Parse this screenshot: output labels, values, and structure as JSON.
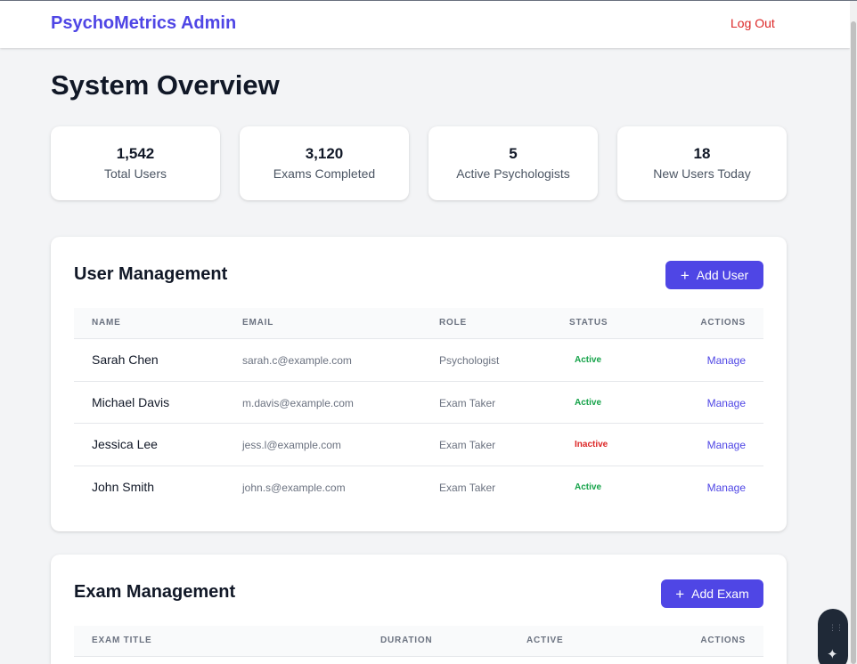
{
  "header": {
    "brand": "PsychoMetrics Admin",
    "logout_label": "Log Out"
  },
  "page": {
    "title": "System Overview"
  },
  "stats": [
    {
      "value": "1,542",
      "label": "Total Users"
    },
    {
      "value": "3,120",
      "label": "Exams Completed"
    },
    {
      "value": "5",
      "label": "Active Psychologists"
    },
    {
      "value": "18",
      "label": "New Users Today"
    }
  ],
  "user_management": {
    "title": "User Management",
    "add_button_label": "Add User",
    "add_button_icon": "plus-icon",
    "columns": [
      "Name",
      "Email",
      "Role",
      "Status",
      "Actions"
    ],
    "rows": [
      {
        "name": "Sarah Chen",
        "email": "sarah.c@example.com",
        "role": "Psychologist",
        "status": "Active",
        "action": "Manage"
      },
      {
        "name": "Michael Davis",
        "email": "m.davis@example.com",
        "role": "Exam Taker",
        "status": "Active",
        "action": "Manage"
      },
      {
        "name": "Jessica Lee",
        "email": "jess.l@example.com",
        "role": "Exam Taker",
        "status": "Inactive",
        "action": "Manage"
      },
      {
        "name": "John Smith",
        "email": "john.s@example.com",
        "role": "Exam Taker",
        "status": "Active",
        "action": "Manage"
      }
    ]
  },
  "exam_management": {
    "title": "Exam Management",
    "add_button_label": "Add Exam",
    "add_button_icon": "plus-icon",
    "columns": [
      "Exam Title",
      "Duration",
      "Active",
      "Actions"
    ]
  },
  "colors": {
    "accent": "#4f46e5",
    "danger": "#dc2626",
    "success": "#16a34a",
    "background": "#f3f4f6"
  }
}
